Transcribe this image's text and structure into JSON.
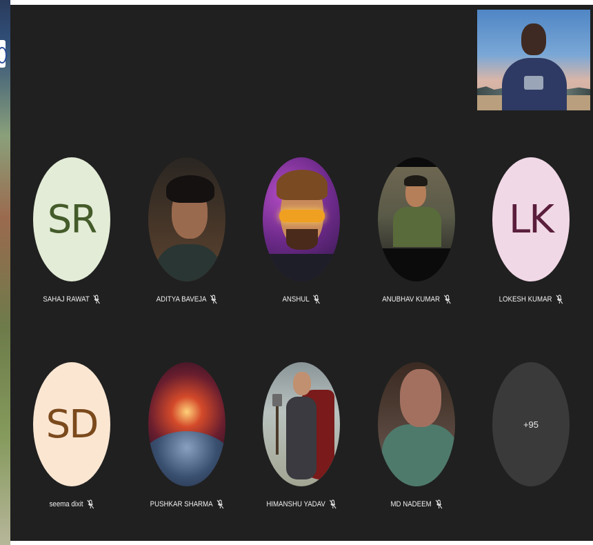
{
  "meeting": {
    "self_view": {
      "label": ""
    },
    "participants": [
      {
        "initials": "SR",
        "name": "SAHAJ RAWAT",
        "avatar_type": "initials",
        "avatar_bg": "#e3ecd6",
        "avatar_fg": "#445b2a",
        "muted": true
      },
      {
        "initials": "",
        "name": "ADITYA BAVEJA",
        "avatar_type": "photo",
        "muted": true
      },
      {
        "initials": "",
        "name": "ANSHUL",
        "avatar_type": "photo",
        "muted": true
      },
      {
        "initials": "",
        "name": "ANUBHAV KUMAR",
        "avatar_type": "photo",
        "muted": true
      },
      {
        "initials": "LK",
        "name": "LOKESH KUMAR",
        "avatar_type": "initials",
        "avatar_bg": "#f1d8e6",
        "avatar_fg": "#5a1e3c",
        "muted": true
      },
      {
        "initials": "SD",
        "name": "seema dixit",
        "avatar_type": "initials",
        "avatar_bg": "#fbe6d2",
        "avatar_fg": "#7b4a1c",
        "muted": true
      },
      {
        "initials": "",
        "name": "PUSHKAR SHARMA",
        "avatar_type": "photo",
        "muted": true
      },
      {
        "initials": "",
        "name": "HIMANSHU YADAV",
        "avatar_type": "photo",
        "muted": true
      },
      {
        "initials": "",
        "name": "MD NADEEM",
        "avatar_type": "photo",
        "muted": true
      }
    ],
    "overflow": {
      "label": "+95"
    }
  },
  "colors": {
    "stage_bg": "#202020",
    "name_text": "#f0f0f0",
    "overflow_bg": "#3a3a3a"
  },
  "icons": {
    "mic_off": "mic-off-icon"
  }
}
